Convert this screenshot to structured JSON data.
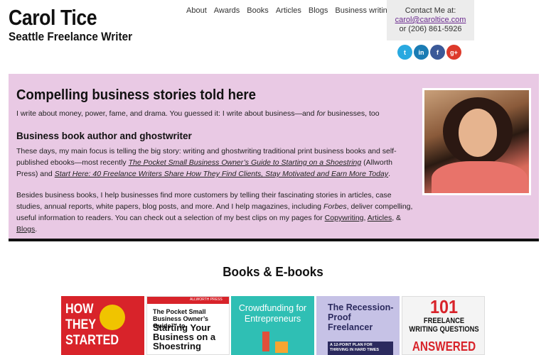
{
  "header": {
    "name": "Carol Tice",
    "tagline": "Seattle Freelance Writer"
  },
  "nav": {
    "items": [
      "About",
      "Awards",
      "Books",
      "Articles",
      "Blogs",
      "Business writing"
    ]
  },
  "contact": {
    "label": "Contact Me at:",
    "email": "carol@caroltice.com",
    "phone": "or (206) 861-5926"
  },
  "social": {
    "twitter": "t",
    "linkedin": "in",
    "facebook": "f",
    "googleplus": "g+"
  },
  "hero": {
    "title": "Compelling business stories told here",
    "intro_a": "I write about money, power, fame, and drama. You guessed it: I write about business—and ",
    "intro_em": "for",
    "intro_b": " businesses, too",
    "subtitle": "Business book author and ghostwriter",
    "p1_a": "These days, my main focus is telling the big story: writing and ghostwriting traditional print business books and self-published ebooks—most recently ",
    "p1_link1": "The Pocket Small Business Owner’s Guide to Starting on a Shoestring",
    "p1_b": " (Allworth Press) and ",
    "p1_link2": "Start Here: 40 Freelance Writers Share How They Find Clients, Stay Motivated and Earn More Today",
    "p1_c": ".",
    "p2_a": "Besides business books, I help businesses find more customers by telling their fascinating stories in articles, case studies, annual reports, white papers, blog posts, and more. And I help magazines, including ",
    "p2_em": "Forbes",
    "p2_b": ", deliver compelling, useful information to readers. You can check out a selection of my best clips on my pages for ",
    "p2_link1": "Copywriting",
    "p2_sep1": ", ",
    "p2_link2": "Articles",
    "p2_sep2": ", & ",
    "p2_link3": "Blogs",
    "p2_c": "."
  },
  "books_section": {
    "title": "Books & E-books",
    "books": [
      {
        "title": "HOW THEY STARTED"
      },
      {
        "publisher": "ALLWORTH PRESS",
        "title_small": "The Pocket Small Business Owner’s Guide™ to",
        "title_large": "Starting Your Business on a Shoestring"
      },
      {
        "title": "Crowdfunding for Entrepreneurs"
      },
      {
        "title": "The Recession-Proof Freelancer",
        "subtitle": "A 12-POINT PLAN FOR THRIVING IN HARD TIMES"
      },
      {
        "number": "101",
        "title": "FREELANCE WRITING QUESTIONS",
        "answer": "ANSWERED"
      }
    ]
  },
  "colors": {
    "hero_bg": "#e9c9e4",
    "link": "#6b2a8f",
    "contact_bg": "#ececec"
  }
}
